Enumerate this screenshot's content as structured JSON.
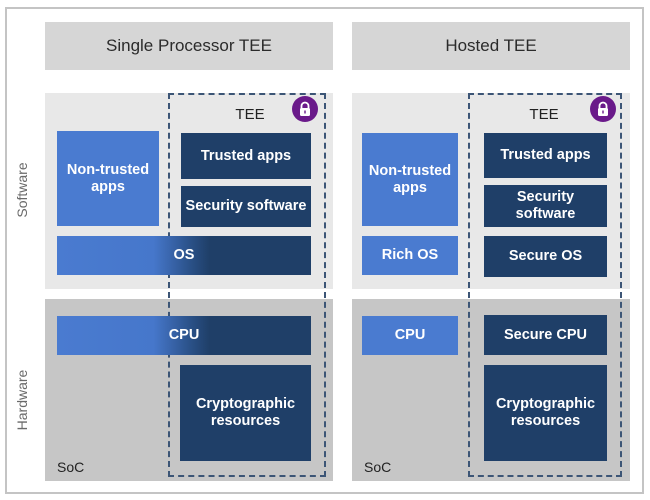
{
  "side_labels": {
    "software": "Software",
    "hardware": "Hardware"
  },
  "colors": {
    "non_trusted": "#4a7bd0",
    "trusted": "#1f3f68",
    "software_panel": "#e8e8e8",
    "hardware_panel": "#c6c6c6",
    "header": "#d6d6d6",
    "lock": "#6a1a8a"
  },
  "left": {
    "title": "Single Processor TEE",
    "tee_label": "TEE",
    "non_trusted_apps": "Non-trusted\napps",
    "trusted_apps": "Trusted apps",
    "security_software": "Security software",
    "os": "OS",
    "cpu": "CPU",
    "crypto": "Cryptographic\nresources",
    "soc": "SoC"
  },
  "right": {
    "title": "Hosted TEE",
    "tee_label": "TEE",
    "non_trusted_apps": "Non-trusted\napps",
    "trusted_apps": "Trusted apps",
    "security_software": "Security\nsoftware",
    "rich_os": "Rich OS",
    "secure_os": "Secure OS",
    "cpu": "CPU",
    "secure_cpu": "Secure CPU",
    "crypto": "Cryptographic\nresources",
    "soc": "SoC"
  },
  "icons": {
    "lock": "lock-icon"
  }
}
